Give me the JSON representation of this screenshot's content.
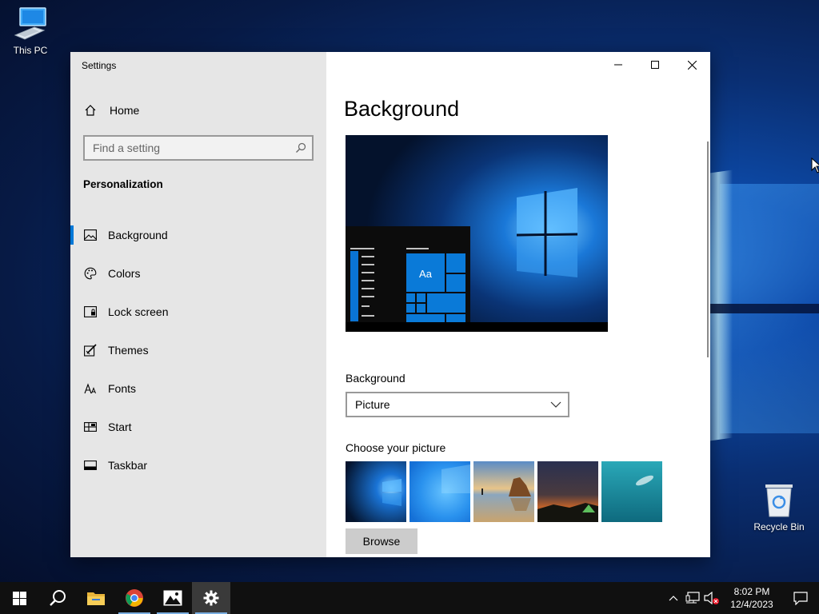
{
  "desktop": {
    "this_pc_label": "This PC",
    "recycle_bin_label": "Recycle Bin"
  },
  "window": {
    "title": "Settings",
    "caption_buttons": [
      "minimize-icon",
      "maximize-icon",
      "close-icon"
    ]
  },
  "nav": {
    "home_label": "Home",
    "search_placeholder": "Find a setting",
    "section": "Personalization",
    "items": [
      {
        "label": "Background",
        "icon": "picture-icon",
        "active": true
      },
      {
        "label": "Colors",
        "icon": "palette-icon",
        "active": false
      },
      {
        "label": "Lock screen",
        "icon": "lock-screen-icon",
        "active": false
      },
      {
        "label": "Themes",
        "icon": "themes-icon",
        "active": false
      },
      {
        "label": "Fonts",
        "icon": "fonts-icon",
        "active": false
      },
      {
        "label": "Start",
        "icon": "start-icon",
        "active": false
      },
      {
        "label": "Taskbar",
        "icon": "taskbar-icon",
        "active": false
      }
    ]
  },
  "content": {
    "title": "Background",
    "preview_tile_text": "Aa",
    "background_label": "Background",
    "background_value": "Picture",
    "choose_picture_label": "Choose your picture",
    "browse_label": "Browse",
    "accent_color": "#0078d7"
  },
  "taskbar": {
    "apps": [
      "start-icon",
      "search-icon",
      "file-explorer-icon",
      "chrome-icon",
      "photos-icon",
      "settings-icon"
    ],
    "time": "8:02 PM",
    "date": "12/4/2023"
  }
}
